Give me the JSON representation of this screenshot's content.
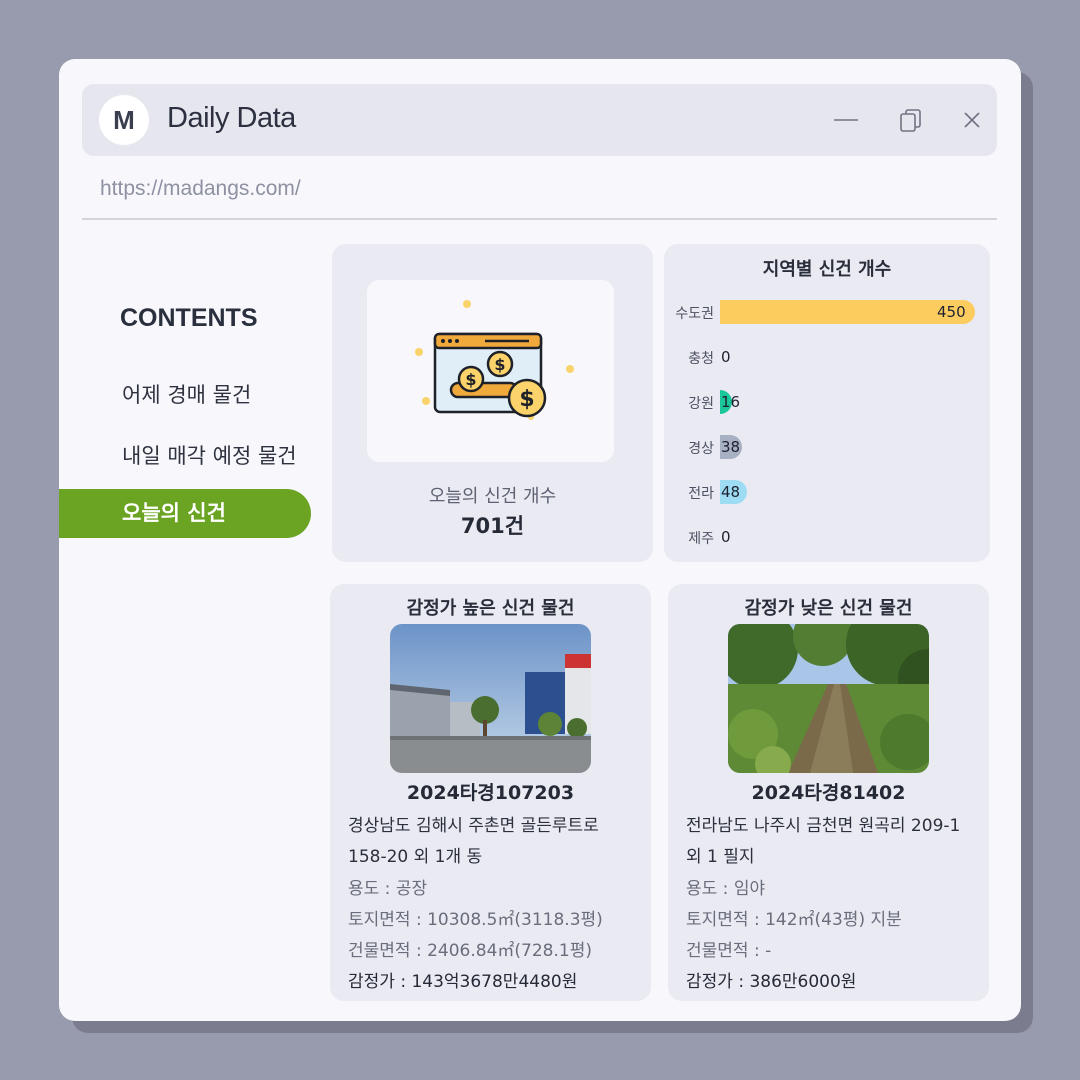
{
  "app": {
    "logo_letter": "M",
    "title": "Daily Data",
    "url": "https://madangs.com/"
  },
  "sidebar": {
    "heading": "CONTENTS",
    "items": [
      {
        "label": "어제 경매 물건",
        "active": false
      },
      {
        "label": "내일 매각 예정 물건",
        "active": false
      },
      {
        "label": "오늘의 신건",
        "active": true
      }
    ]
  },
  "today_count": {
    "icon": "money-browser-icon",
    "label": "오늘의 신건 개수",
    "value": "701건"
  },
  "regions": {
    "title": "지역별 신건 개수",
    "chart_data": {
      "type": "bar",
      "orientation": "horizontal",
      "categories": [
        "수도권",
        "충청",
        "강원",
        "경상",
        "전라",
        "제주"
      ],
      "values": [
        450,
        0,
        16,
        38,
        48,
        0
      ],
      "colors": [
        "#fccc5f",
        "#fccc5f",
        "#1bc79a",
        "#a8b0c4",
        "#9edcf4",
        "#cccccc"
      ]
    }
  },
  "high_property": {
    "heading": "감정가 높은 신건 물건",
    "case_no": "2024타경107203",
    "address": "경상남도 김해시 주촌면 골든루트로 158-20 외 1개 동",
    "usage": "용도 : 공장",
    "land_area": "토지면적 : 10308.5㎡(3118.3평)",
    "building_area": "건물면적 : 2406.84㎡(728.1평)",
    "appraisal": "감정가 : 143억3678만4480원"
  },
  "low_property": {
    "heading": "감정가 낮은 신건 물건",
    "case_no": "2024타경81402",
    "address": "전라남도 나주시 금천면 원곡리 209-1 외 1 필지",
    "usage": "용도 : 임야",
    "land_area": "토지면적 : 142㎡(43평) 지분",
    "building_area": "건물면적 : -",
    "appraisal": "감정가 : 386만6000원"
  },
  "colors": {
    "accent_green": "#6ba322",
    "window_bg": "#f7f7fc",
    "panel_bg": "#e9eaf2",
    "page_bg": "#989aad"
  }
}
